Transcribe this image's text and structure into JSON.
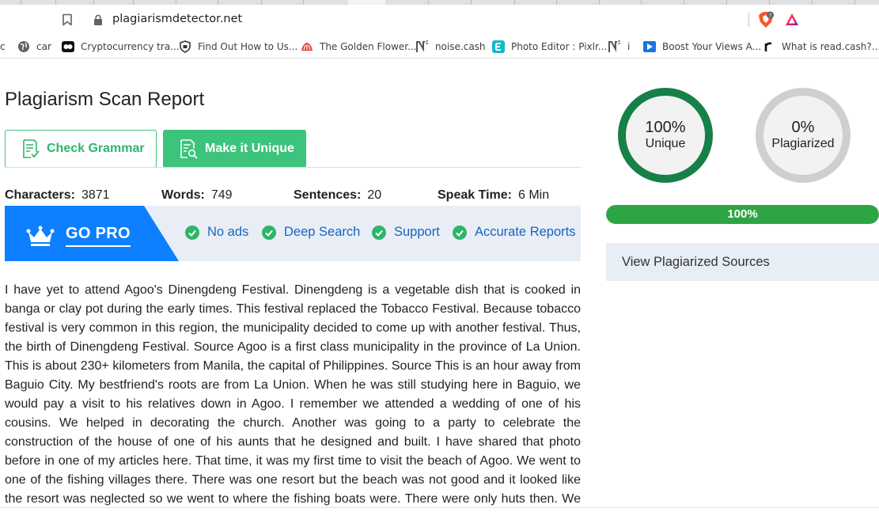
{
  "browser": {
    "url": "plagiarismdetector.net",
    "shield_badge": "7",
    "bookmarks": [
      {
        "label": "c",
        "icon": "none"
      },
      {
        "label": "car",
        "icon": "globe-icon"
      },
      {
        "label": "Cryptocurrency tra...",
        "icon": "crypto-site-icon"
      },
      {
        "label": "Find Out How to Us...",
        "icon": "shield-site-icon"
      },
      {
        "label": "The Golden Flower...",
        "icon": "flower-site-icon"
      },
      {
        "label": "noise.cash",
        "icon": "noise-cash-icon"
      },
      {
        "label": "Photo Editor : Pixlr...",
        "icon": "pixlr-icon"
      },
      {
        "label": "i",
        "icon": "noise-cash-icon"
      },
      {
        "label": "Boost Your Views A...",
        "icon": "play-site-icon"
      },
      {
        "label": "What is read.cash?...",
        "icon": "read-cash-icon"
      }
    ]
  },
  "report": {
    "title": "Plagiarism Scan Report",
    "check_grammar_label": "Check Grammar",
    "make_unique_label": "Make it Unique",
    "stats": {
      "characters_label": "Characters:",
      "characters_value": "3871",
      "words_label": "Words:",
      "words_value": "749",
      "sentences_label": "Sentences:",
      "sentences_value": "20",
      "speak_time_label": "Speak Time:",
      "speak_time_value": "6 Min"
    },
    "pro_banner": {
      "label": "GO PRO",
      "features": [
        "No ads",
        "Deep Search",
        "Support",
        "Accurate Reports"
      ]
    },
    "article_lines": [
      "I have yet to attend Agoo's Dinengdeng Festival. Dinengdeng is a vegetable dish that is cooked in",
      "banga or clay pot during the early times. This festival replaced the Tobacco Festival. Because tobacco",
      "festival is very common in this region, the municipality decided to come up with another festival. Thus,",
      "the birth of Dinengdeng Festival. Source Agoo is a first class municipality in the province of La Union.",
      "This is about 230+ kilometers from Manila, the capital of Philippines. Source This is an hour away from",
      "Baguio City. My bestfriend's roots are from La Union. When he was still studying here in Baguio, we",
      "would pay a visit to his relatives down in Agoo. I remember we attended a wedding of one of his",
      "cousins. We helped in decorating the church. Another was going to a party to celebrate the",
      "construction of the house of one of his aunts that he designed and built. I have shared that photo",
      "before in one of my articles here. That time, it was my first time to visit the beach of Agoo. We went to",
      "one of the fishing villages there. There was one resort but the beach was not good and it looked like",
      "the resort was neglected so we went to where the fishing boats were. There were only huts then. We"
    ]
  },
  "results": {
    "unique_pct": "100%",
    "unique_label": "Unique",
    "plagiarized_pct": "0%",
    "plagiarized_label": "Plagiarized",
    "progress_value": 1.0,
    "progress_label": "100%",
    "sources_label": "View Plagiarized Sources"
  },
  "colors": {
    "unique_ring": "#168048",
    "plagiarized_ring": "#cfcfcf",
    "progress_fill": "#2ea544",
    "button_green": "#3cc47c",
    "pro_blue": "#0d7fff",
    "feature_text": "#1565c0"
  }
}
